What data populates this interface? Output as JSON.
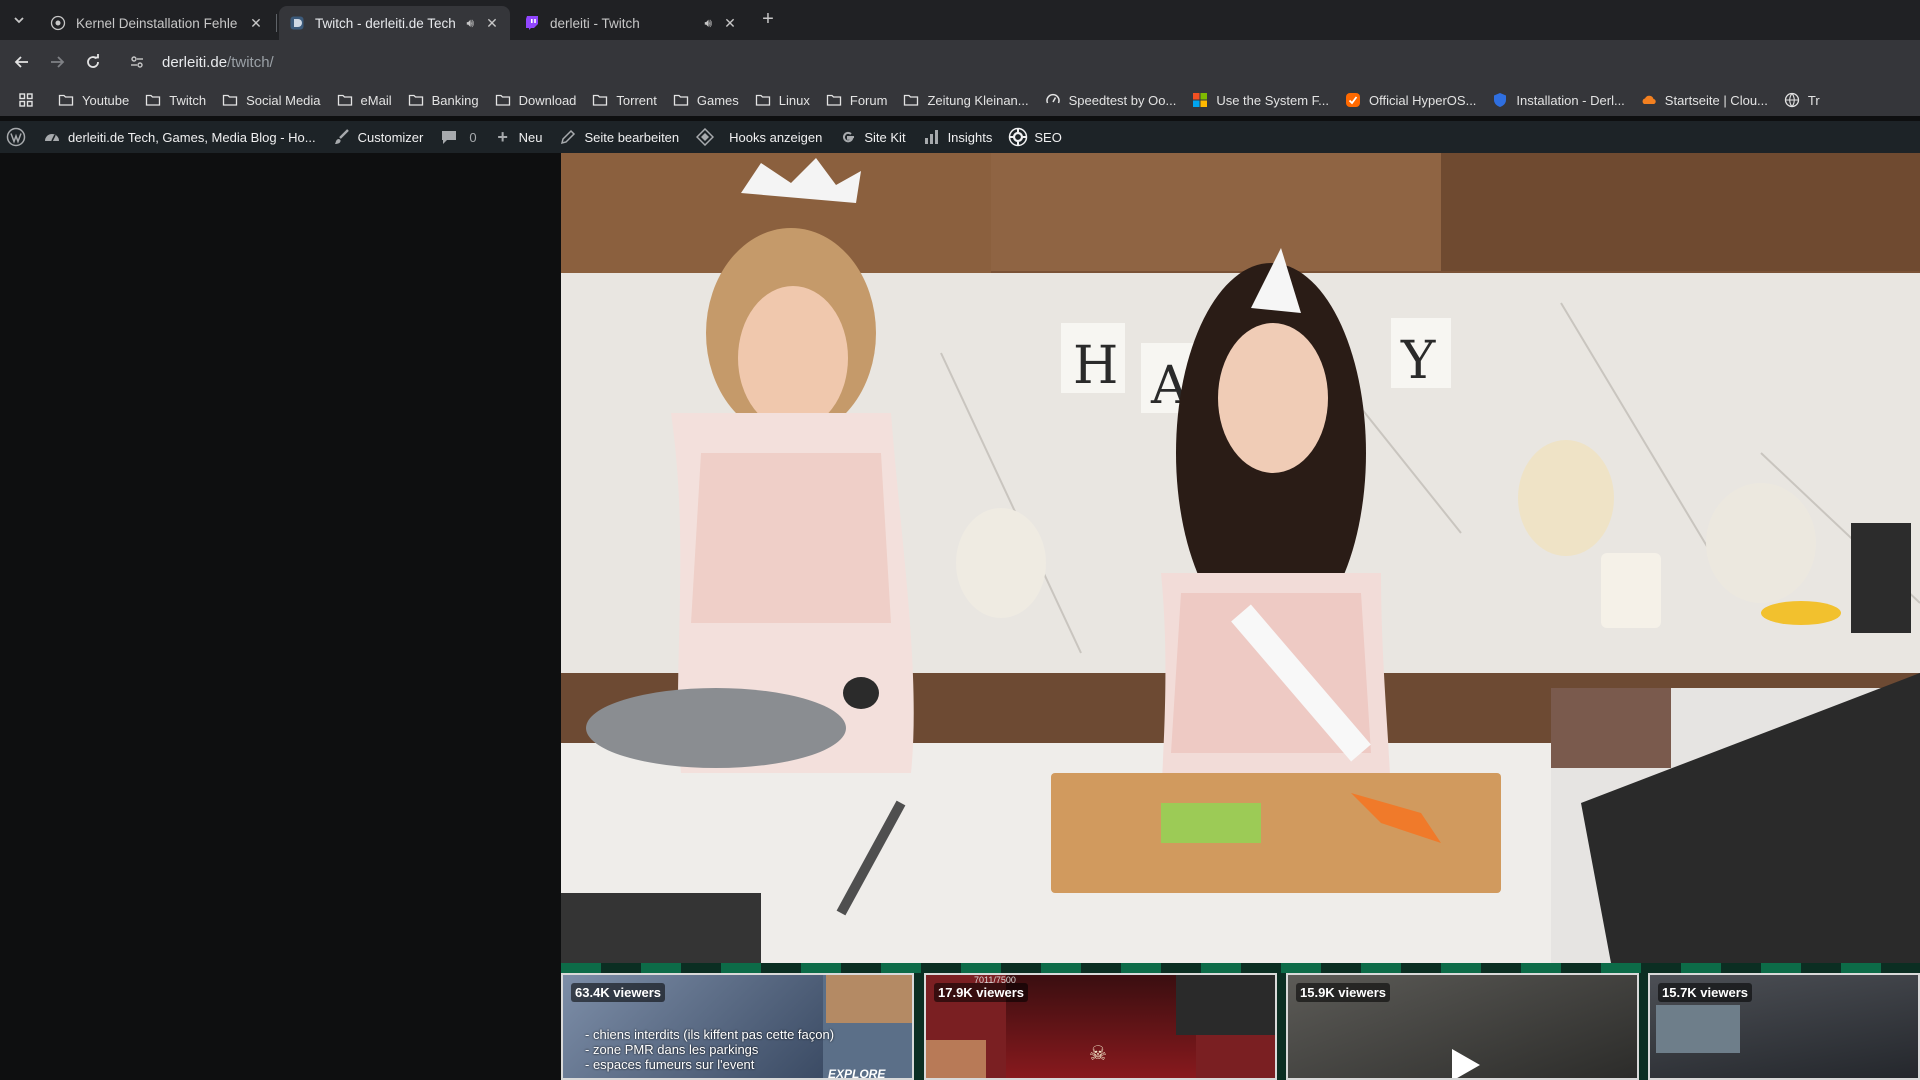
{
  "tabs": [
    {
      "title": "Kernel Deinstallation Fehler",
      "favicon": "globe-favicon-icon",
      "has_audio": false
    },
    {
      "title": "Twitch - derleiti.de Tech",
      "favicon": "derleiti-favicon-icon",
      "has_audio": true
    },
    {
      "title": "derleiti - Twitch",
      "favicon": "twitch-favicon-icon",
      "has_audio": true
    }
  ],
  "omnibox": {
    "host": "derleiti.de",
    "path": "/twitch/"
  },
  "bookmarks": [
    {
      "label": "Youtube",
      "icon": "folder-icon"
    },
    {
      "label": "Twitch",
      "icon": "folder-icon"
    },
    {
      "label": "Social Media",
      "icon": "folder-icon"
    },
    {
      "label": "eMail",
      "icon": "folder-icon"
    },
    {
      "label": "Banking",
      "icon": "folder-icon"
    },
    {
      "label": "Download",
      "icon": "folder-icon"
    },
    {
      "label": "Torrent",
      "icon": "folder-icon"
    },
    {
      "label": "Games",
      "icon": "folder-icon"
    },
    {
      "label": "Linux",
      "icon": "folder-icon"
    },
    {
      "label": "Forum",
      "icon": "folder-icon"
    },
    {
      "label": "Zeitung Kleinan...",
      "icon": "folder-icon"
    },
    {
      "label": "Speedtest by Oo...",
      "icon": "speedtest-icon"
    },
    {
      "label": "Use the System F...",
      "icon": "microsoft-icon"
    },
    {
      "label": "Official HyperOS...",
      "icon": "hyperos-icon"
    },
    {
      "label": "Installation - Derl...",
      "icon": "shield-icon"
    },
    {
      "label": "Startseite | Clou...",
      "icon": "cloud-icon"
    },
    {
      "label": "Tr",
      "icon": "globe-icon"
    }
  ],
  "adminbar": {
    "site_name": "derleiti.de Tech, Games, Media Blog - Ho...",
    "customizer": "Customizer",
    "comments_count": "0",
    "new": "Neu",
    "edit_page": "Seite bearbeiten",
    "hooks": "Hooks anzeigen",
    "site_kit": "Site Kit",
    "insights": "Insights",
    "seo": "SEO"
  },
  "video": {
    "banner_letters": [
      "H",
      "A",
      "Y"
    ]
  },
  "thumbnails": [
    {
      "viewers": "63.4K viewers",
      "overlay_lines": [
        "- chiens interdits (ils kiffent pas cette façon)",
        "- zone PMR dans les parkings",
        "- espaces fumeurs sur l'event"
      ],
      "tag": "EXPLORE"
    },
    {
      "viewers": "17.9K viewers",
      "counter": "7011/7500"
    },
    {
      "viewers": "15.9K viewers"
    },
    {
      "viewers": "15.7K viewers"
    }
  ],
  "colors": {
    "tabstrip": "#202124",
    "toolbar": "#35363a",
    "adminbar": "#1d2327",
    "page_bg": "#0e0f10",
    "twitch_purple": "#9146ff"
  }
}
